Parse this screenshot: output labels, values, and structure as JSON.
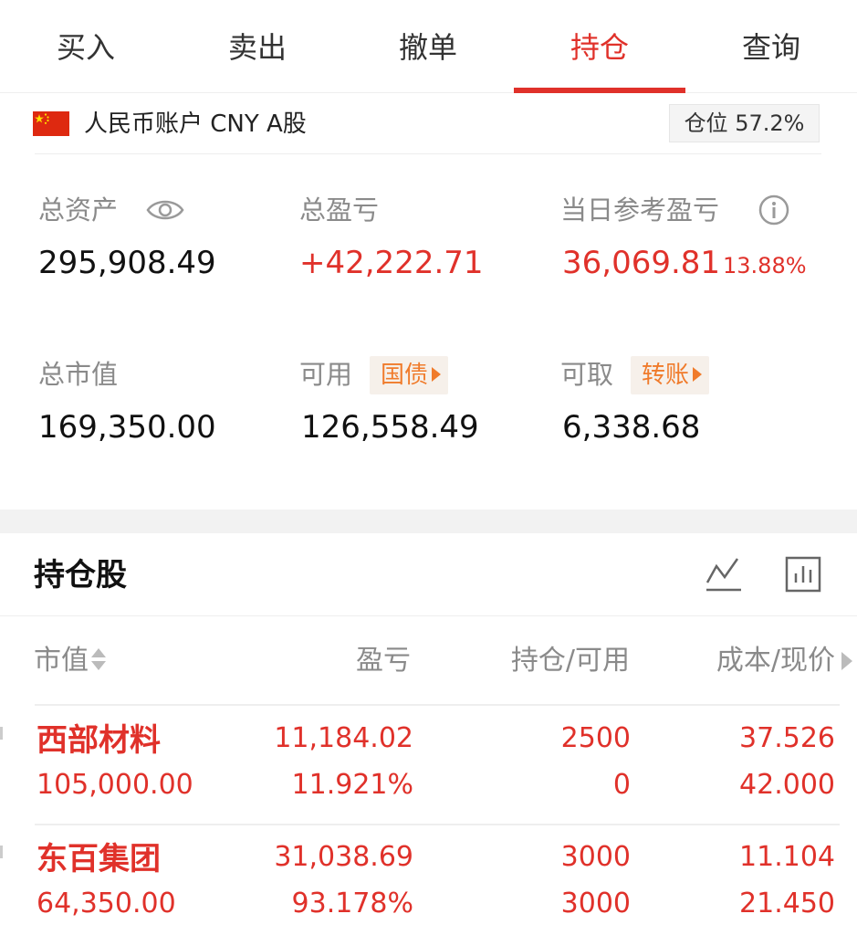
{
  "tabs": [
    {
      "label": "买入",
      "active": false
    },
    {
      "label": "卖出",
      "active": false
    },
    {
      "label": "撤单",
      "active": false
    },
    {
      "label": "持仓",
      "active": true
    },
    {
      "label": "查询",
      "active": false
    }
  ],
  "account": {
    "label": "人民币账户 CNY A股",
    "position_ratio": "仓位 57.2%",
    "flag_icon": "china-flag-icon"
  },
  "summary": {
    "total_assets_label": "总资产",
    "total_assets_value": "295,908.49",
    "total_pnl_label": "总盈亏",
    "total_pnl_value": "+42,222.71",
    "daily_pnl_label": "当日参考盈亏",
    "daily_pnl_value": "36,069.81",
    "daily_pnl_pct": "13.88%",
    "market_value_label": "总市值",
    "market_value_value": "169,350.00",
    "available_label": "可用",
    "available_value": "126,558.49",
    "available_pill": "国债",
    "withdrawable_label": "可取",
    "withdrawable_value": "6,338.68",
    "withdrawable_pill": "转账"
  },
  "holdings": {
    "title": "持仓股",
    "columns": [
      "市值",
      "盈亏",
      "持仓/可用",
      "成本/现价"
    ],
    "rows": [
      {
        "name": "西部材料",
        "market_value": "105,000.00",
        "pnl": "11,184.02",
        "pnl_pct": "11.921%",
        "position": "2500",
        "available": "0",
        "cost": "37.526",
        "price": "42.000"
      },
      {
        "name": "东百集团",
        "market_value": "64,350.00",
        "pnl": "31,038.69",
        "pnl_pct": "93.178%",
        "position": "3000",
        "available": "3000",
        "cost": "11.104",
        "price": "21.450"
      }
    ]
  },
  "colors": {
    "accent_red": "#e0312a",
    "label_gray": "#8a8a8a",
    "pill_orange": "#f07b2b"
  }
}
